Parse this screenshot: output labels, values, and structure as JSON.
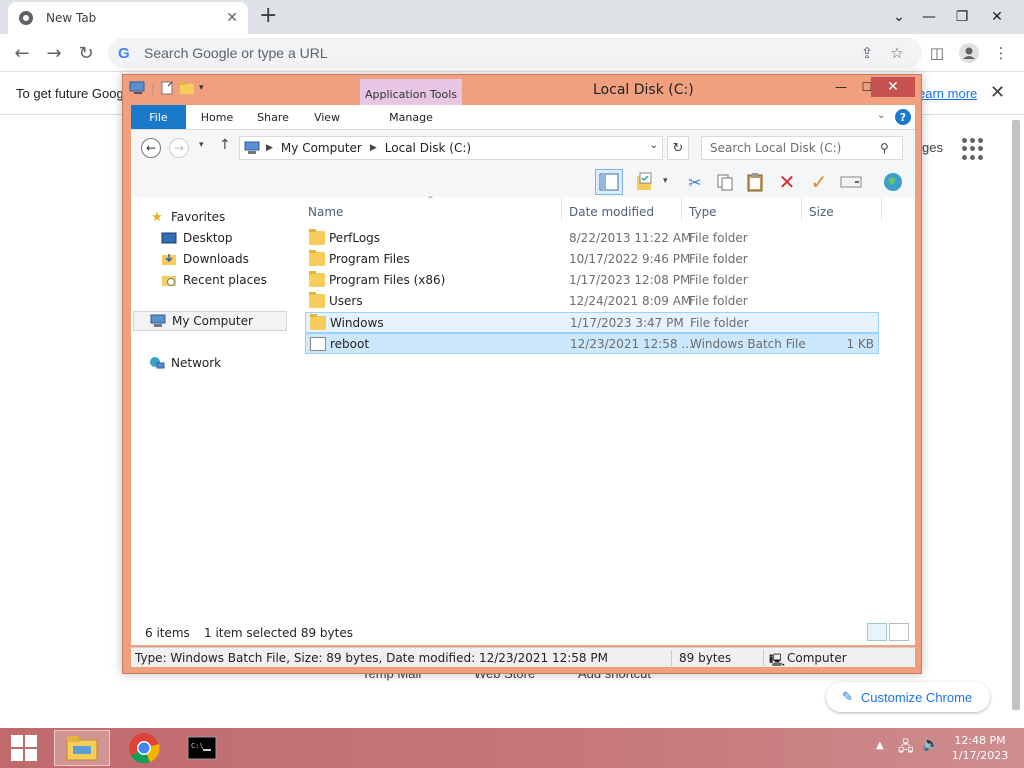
{
  "browser": {
    "tab_title": "New Tab",
    "omnibox_placeholder": "Search Google or type a URL",
    "infobar_message": "To get future Goog",
    "infobar_link": "earn more",
    "ntp_partial_right": "ges",
    "ntp_shortcuts_partial": [
      "Temp Mail",
      "Web Store",
      "Add shortcut"
    ],
    "customize_label": "Customize Chrome"
  },
  "explorer": {
    "window_title": "Local Disk (C:)",
    "contextual_tab": "Application Tools",
    "ribbon_tabs": [
      "File",
      "Home",
      "Share",
      "View",
      "Manage"
    ],
    "breadcrumb": [
      "My Computer",
      "Local Disk (C:)"
    ],
    "search_placeholder": "Search Local Disk (C:)",
    "nav": {
      "favorites": "Favorites",
      "desktop": "Desktop",
      "downloads": "Downloads",
      "recent": "Recent places",
      "computer": "My Computer",
      "network": "Network"
    },
    "columns": [
      "Name",
      "Date modified",
      "Type",
      "Size"
    ],
    "files": [
      {
        "name": "PerfLogs",
        "date": "8/22/2013 11:22 AM",
        "type": "File folder",
        "size": ""
      },
      {
        "name": "Program Files",
        "date": "10/17/2022 9:46 PM",
        "type": "File folder",
        "size": ""
      },
      {
        "name": "Program Files (x86)",
        "date": "1/17/2023 12:08 PM",
        "type": "File folder",
        "size": ""
      },
      {
        "name": "Users",
        "date": "12/24/2021 8:09 AM",
        "type": "File folder",
        "size": ""
      },
      {
        "name": "Windows",
        "date": "1/17/2023 3:47 PM",
        "type": "File folder",
        "size": ""
      },
      {
        "name": "reboot",
        "date": "12/23/2021 12:58 ...",
        "type": "Windows Batch File",
        "size": "1 KB"
      }
    ],
    "item_count": "6 items",
    "selection_info": "1 item selected  89 bytes",
    "status_details": "Type: Windows Batch File, Size: 89 bytes, Date modified: 12/23/2021 12:58 PM",
    "status_size": "89 bytes",
    "status_location": "Computer"
  },
  "taskbar": {
    "time": "12:48 PM",
    "date": "1/17/2023"
  },
  "colors": {
    "window_frame": "#f0a07f",
    "file_tab": "#1979ca",
    "selection": "#cce8ff",
    "taskbar": "#c6787a"
  }
}
